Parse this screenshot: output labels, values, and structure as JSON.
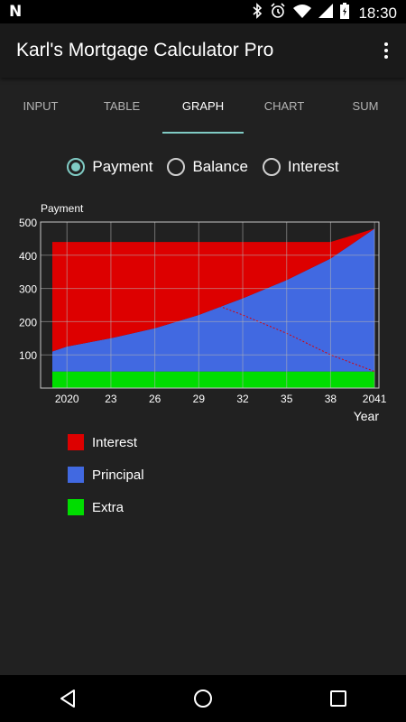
{
  "status_bar": {
    "left_icon": "N",
    "time": "18:30",
    "icons": [
      "bluetooth-icon",
      "alarm-icon",
      "wifi-icon",
      "signal-icon",
      "battery-icon"
    ]
  },
  "app": {
    "title": "Karl's Mortgage Calculator Pro",
    "menu_icon": "overflow-menu-icon"
  },
  "tabs": [
    {
      "label": "INPUT",
      "active": false
    },
    {
      "label": "TABLE",
      "active": false
    },
    {
      "label": "GRAPH",
      "active": true
    },
    {
      "label": "CHART",
      "active": false
    },
    {
      "label": "SUM",
      "active": false
    }
  ],
  "graph_options": [
    {
      "label": "Payment",
      "checked": true
    },
    {
      "label": "Balance",
      "checked": false
    },
    {
      "label": "Interest",
      "checked": false
    }
  ],
  "chart_data": {
    "type": "area",
    "ylabel": "Payment",
    "xlabel": "Year",
    "x": [
      2019,
      2020,
      2023,
      2026,
      2029,
      2032,
      2035,
      2038,
      2041
    ],
    "x_tick_labels": [
      "2020",
      "23",
      "26",
      "29",
      "32",
      "35",
      "38",
      "2041"
    ],
    "x_tick_values": [
      2020,
      2023,
      2026,
      2029,
      2032,
      2035,
      2038,
      2041
    ],
    "xlim": [
      2018.2,
      2041.3
    ],
    "ylim": [
      0,
      500
    ],
    "y_ticks": [
      100,
      200,
      300,
      400,
      500
    ],
    "grid": true,
    "legend": "below",
    "stacked": true,
    "series": [
      {
        "name": "Extra",
        "color": "#00dd00",
        "values": [
          50,
          50,
          50,
          50,
          50,
          50,
          50,
          50,
          50
        ]
      },
      {
        "name": "Principal",
        "color": "#4169e1",
        "values": [
          60,
          75,
          100,
          130,
          170,
          220,
          275,
          340,
          430
        ]
      },
      {
        "name": "Interest",
        "color": "#dd0000",
        "values": [
          330,
          315,
          290,
          260,
          220,
          170,
          115,
          50,
          0
        ]
      }
    ]
  },
  "legend": [
    {
      "label": "Interest",
      "color": "#dd0000"
    },
    {
      "label": "Principal",
      "color": "#4169e1"
    },
    {
      "label": "Extra",
      "color": "#00dd00"
    }
  ],
  "nav": [
    "back-icon",
    "home-icon",
    "recents-icon"
  ]
}
